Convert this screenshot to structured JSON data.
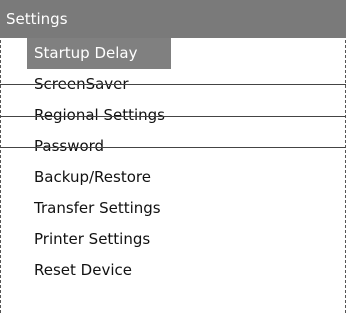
{
  "window": {
    "title": "Settings"
  },
  "menu": {
    "items": [
      {
        "label": "Startup Delay",
        "selected": true
      },
      {
        "label": "ScreenSaver",
        "selected": false
      },
      {
        "label": "Regional Settings",
        "selected": false
      },
      {
        "label": "Password",
        "selected": false
      },
      {
        "label": "Backup/Restore",
        "selected": false
      },
      {
        "label": "Transfer Settings",
        "selected": false
      },
      {
        "label": "Printer Settings",
        "selected": false
      },
      {
        "label": "Reset Device",
        "selected": false
      }
    ]
  },
  "colors": {
    "title_bar": "#7a7a7a",
    "selection": "#808080",
    "selected_text": "#ffffff",
    "text": "#111111"
  }
}
